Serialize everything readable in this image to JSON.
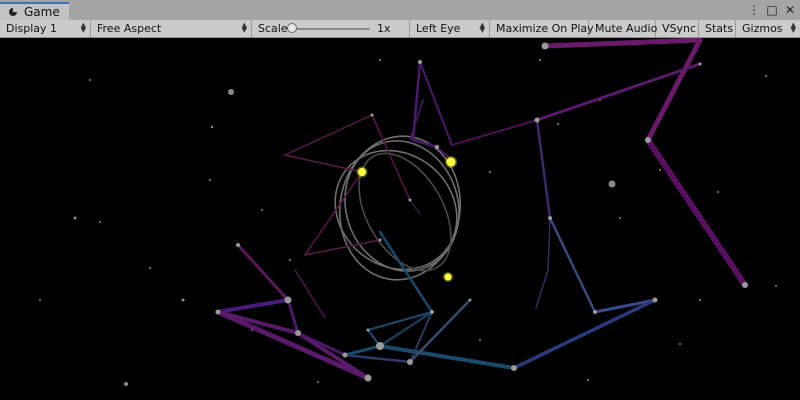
{
  "window": {
    "tab_label": "Game",
    "tab_icon": "game-controller-icon",
    "controls": {
      "menu": "⋮",
      "maximize": "□",
      "close": "✕"
    }
  },
  "toolbar": {
    "display": "Display 1",
    "aspect": "Free Aspect",
    "scale_label": "Scale",
    "scale_value": "1x",
    "scale_fraction": 0.0,
    "eye": "Left Eye",
    "maximize_on_play": "Maximize On Play",
    "mute_audio": "Mute Audio",
    "vsync": "VSync",
    "stats": "Stats",
    "gizmos": "Gizmos"
  },
  "scene": {
    "background_color": "#000000",
    "highlight_color": "#ffff33",
    "orbit_color": "#7a7a7a"
  }
}
